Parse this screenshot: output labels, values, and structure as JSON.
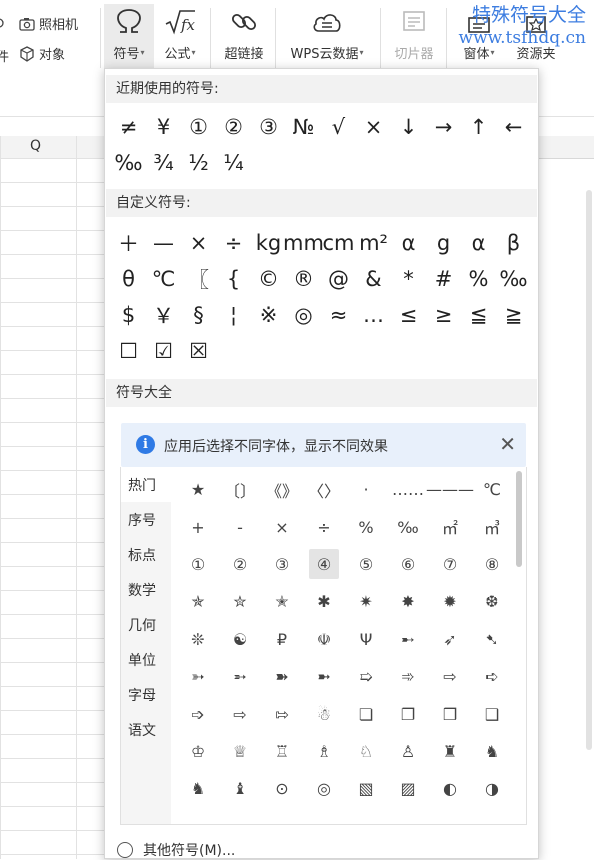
{
  "watermark": {
    "line1": "特殊符号大全",
    "line2": "www.tsfhdq.cn"
  },
  "ribbon": {
    "left_label_1": "件",
    "camera_label": "照相机",
    "object_label": "对象",
    "buttons": [
      {
        "label": "符号",
        "icon": "omega-icon"
      },
      {
        "label": "公式",
        "icon": "sqrt-fx-icon"
      },
      {
        "label": "超链接",
        "icon": "link-icon"
      },
      {
        "label": "WPS云数据",
        "icon": "cloud-data-icon"
      },
      {
        "label": "切片器",
        "icon": "slicer-icon"
      },
      {
        "label": "窗体",
        "icon": "form-icon"
      },
      {
        "label": "资源夹",
        "icon": "resource-folder-icon"
      }
    ]
  },
  "sheet": {
    "column_q": "Q"
  },
  "popup": {
    "recent_title": "近期使用的符号:",
    "recent_symbols": [
      "≠",
      "¥",
      "①",
      "②",
      "③",
      "№",
      "√",
      "×",
      "↓",
      "→",
      "↑",
      "←",
      "‰",
      "¾",
      "½",
      "¼"
    ],
    "custom_title": "自定义符号:",
    "custom_symbols": [
      "＋",
      "—",
      "×",
      "÷",
      "kg",
      "mm",
      "cm",
      "m²",
      "α",
      "g",
      "α",
      "β",
      "θ",
      "℃",
      "〖",
      "{",
      "©",
      "®",
      "@",
      "&",
      "*",
      "#",
      "%",
      "‰",
      "$",
      "￥",
      "§",
      "¦",
      "※",
      "◎",
      "≈",
      "…",
      "≤",
      "≥",
      "≦",
      "≧",
      "☐",
      "☑",
      "☒"
    ],
    "all_title": "符号大全",
    "info_text": "应用后选择不同字体，显示不同效果",
    "categories": [
      "热门",
      "序号",
      "标点",
      "数学",
      "几何",
      "单位",
      "字母",
      "语文"
    ],
    "selected_category": "热门",
    "symbols": [
      "★",
      "〔〕",
      "《》",
      "〈〉",
      "·",
      "……",
      "———",
      "℃",
      "+",
      "-",
      "×",
      "÷",
      "%",
      "‰",
      "㎡",
      "㎥",
      "①",
      "②",
      "③",
      "④",
      "⑤",
      "⑥",
      "⑦",
      "⑧",
      "✯",
      "✮",
      "✭",
      "✱",
      "✷",
      "✸",
      "✹",
      "❆",
      "❊",
      "☯",
      "₽",
      "☫",
      "Ψ",
      "➸",
      "➶",
      "➷",
      "➳",
      "➵",
      "➽",
      "➼",
      "➯",
      "➾",
      "⇨",
      "➪",
      "➩",
      "⇨",
      "⇰",
      "☃",
      "❏",
      "❐",
      "❒",
      "❑",
      "♔",
      "♕",
      "♖",
      "♗",
      "♘",
      "♙",
      "♜",
      "♞",
      "♞",
      "♝",
      "⊙",
      "◎",
      "▧",
      "▨",
      "◐",
      "◑"
    ],
    "highlighted_symbol": "④",
    "more_label": "其他符号(M)..."
  }
}
